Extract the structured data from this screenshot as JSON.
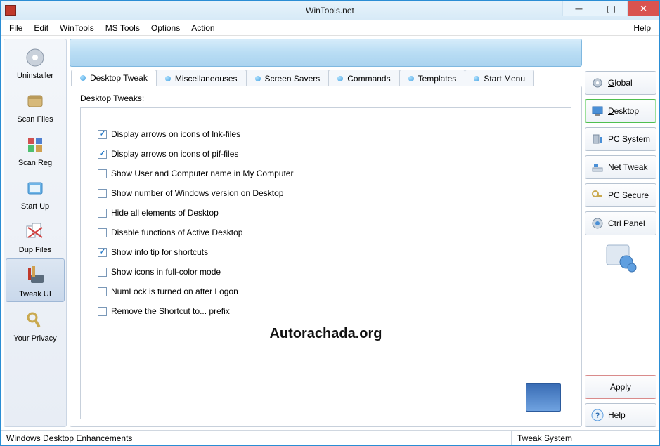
{
  "window": {
    "title": "WinTools.net"
  },
  "menus": {
    "file": "File",
    "edit": "Edit",
    "wintools": "WinTools",
    "mstools": "MS Tools",
    "options": "Options",
    "action": "Action",
    "help": "Help"
  },
  "left_toolbar": {
    "uninstaller": "Uninstaller",
    "scan_files": "Scan Files",
    "scan_reg": "Scan Reg",
    "start_up": "Start Up",
    "dup_files": "Dup Files",
    "tweak_ui": "Tweak UI",
    "your_privacy": "Your Privacy"
  },
  "tabs": {
    "desktop_tweak": "Desktop Tweak",
    "miscellaneouses": "Miscellaneouses",
    "screen_savers": "Screen Savers",
    "commands": "Commands",
    "templates": "Templates",
    "start_menu": "Start Menu"
  },
  "pane": {
    "caption": "Desktop Tweaks:",
    "options": {
      "lnk_arrows": {
        "label": "Display arrows on icons of lnk-files",
        "checked": true
      },
      "pif_arrows": {
        "label": "Display arrows on icons of pif-files",
        "checked": true
      },
      "user_comp_name": {
        "label": "Show User and Computer name in My Computer",
        "checked": false
      },
      "win_version": {
        "label": "Show number of Windows version on Desktop",
        "checked": false
      },
      "hide_elements": {
        "label": "Hide all elements of Desktop",
        "checked": false
      },
      "disable_active": {
        "label": "Disable functions of Active Desktop",
        "checked": false
      },
      "info_tip": {
        "label": "Show info tip for shortcuts",
        "checked": true
      },
      "full_color": {
        "label": "Show icons in full-color mode",
        "checked": false
      },
      "numlock": {
        "label": "NumLock is turned on after Logon",
        "checked": false
      },
      "remove_prefix": {
        "label": "Remove the Shortcut to... prefix",
        "checked": false
      }
    },
    "watermark": "Autorachada.org"
  },
  "right_toolbar": {
    "global": "Global",
    "desktop": "Desktop",
    "pc_system": "PC System",
    "net_tweak": "Net Tweak",
    "pc_secure": "PC Secure",
    "ctrl_panel": "Ctrl Panel",
    "apply": "Apply",
    "help": "Help"
  },
  "status": {
    "left": "Windows Desktop Enhancements",
    "right": "Tweak System"
  }
}
